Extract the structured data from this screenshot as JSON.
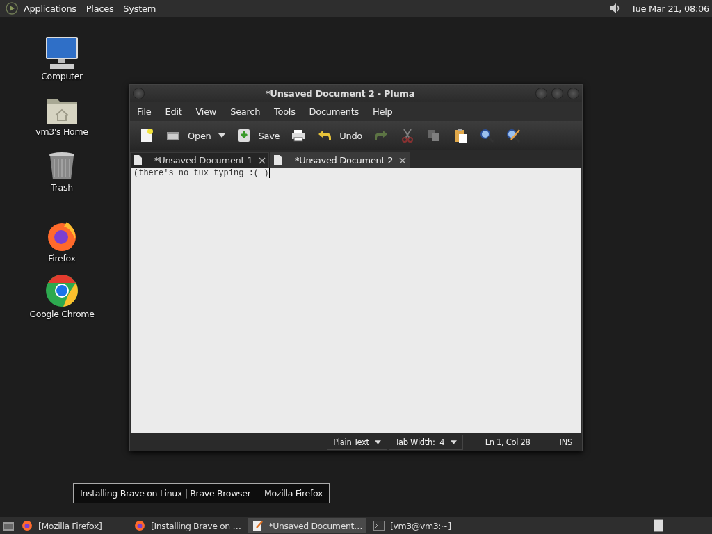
{
  "top_panel": {
    "menus": [
      "Applications",
      "Places",
      "System"
    ],
    "clock": "Tue Mar 21, 08:06"
  },
  "desktop_icons": [
    {
      "label": "Computer",
      "kind": "computer"
    },
    {
      "label": "vm3's Home",
      "kind": "home"
    },
    {
      "label": "Trash",
      "kind": "trash"
    },
    {
      "label": "Firefox",
      "kind": "firefox"
    },
    {
      "label": "Google Chrome",
      "kind": "chrome"
    }
  ],
  "window": {
    "title": "*Unsaved Document 2 - Pluma",
    "menu": [
      "File",
      "Edit",
      "View",
      "Search",
      "Tools",
      "Documents",
      "Help"
    ],
    "toolbar": [
      {
        "kind": "new"
      },
      {
        "kind": "open",
        "label": "Open"
      },
      {
        "kind": "save",
        "label": "Save"
      },
      {
        "kind": "print"
      },
      {
        "kind": "undo",
        "label": "Undo"
      },
      {
        "kind": "redo",
        "disabled": true
      },
      {
        "kind": "cut",
        "disabled": true
      },
      {
        "kind": "copy",
        "disabled": true
      },
      {
        "kind": "paste"
      },
      {
        "kind": "find"
      },
      {
        "kind": "replace"
      }
    ],
    "tabs": [
      {
        "label": "*Unsaved Document 1",
        "selected": false
      },
      {
        "label": "*Unsaved Document 2",
        "selected": true
      }
    ],
    "text": "(there's no tux typing :( )",
    "status": {
      "language": "Plain Text",
      "tab_width": "Tab Width:  4",
      "position": "Ln 1, Col 28",
      "mode": "INS"
    }
  },
  "tooltip": "Installing Brave on Linux | Brave Browser — Mozilla Firefox",
  "taskbar": [
    {
      "label": "[Mozilla Firefox]",
      "kind": "firefox",
      "selected": false
    },
    {
      "label": "[Installing Brave on …",
      "kind": "firefox",
      "selected": false
    },
    {
      "label": "*Unsaved Document…",
      "kind": "editor",
      "selected": true
    },
    {
      "label": "[vm3@vm3:~]",
      "kind": "terminal",
      "selected": false
    }
  ]
}
